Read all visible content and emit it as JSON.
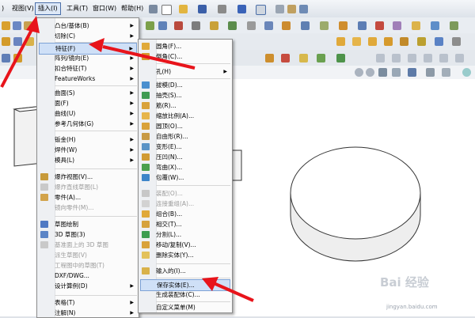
{
  "menubar": {
    "items": [
      "视图(V)",
      "插入(I)",
      "工具(T)",
      "窗口(W)",
      "帮助(H)"
    ]
  },
  "insert_menu": {
    "items": [
      {
        "label": "凸台/基体(B)",
        "has_submenu": true
      },
      {
        "label": "切除(C)",
        "has_submenu": true
      },
      {
        "label": "特征(F)",
        "has_submenu": true,
        "highlighted": true
      },
      {
        "label": "阵列/镜向(E)",
        "has_submenu": true
      },
      {
        "label": "扣合特征(T)",
        "has_submenu": true
      },
      {
        "label": "FeatureWorks",
        "has_submenu": true
      },
      {
        "label": "曲面(S)",
        "has_submenu": true
      },
      {
        "label": "面(F)",
        "has_submenu": true
      },
      {
        "label": "曲线(U)",
        "has_submenu": true
      },
      {
        "label": "参考几何体(G)",
        "has_submenu": true
      },
      {
        "label": "钣金(H)",
        "has_submenu": true
      },
      {
        "label": "焊件(W)",
        "has_submenu": true
      },
      {
        "label": "模具(L)",
        "has_submenu": true
      },
      {
        "label": "爆炸视图(V)...",
        "disabled": false
      },
      {
        "label": "爆炸直线草图(L)",
        "disabled": true
      },
      {
        "label": "零件(A)...",
        "disabled": false
      },
      {
        "label": "镜向零件(M)...",
        "disabled": true
      },
      {
        "label": "草图绘制",
        "disabled": false
      },
      {
        "label": "3D 草图(3)",
        "disabled": false
      },
      {
        "label": "基准面上的 3D 草图",
        "disabled": true
      },
      {
        "label": "派生草图(V)",
        "disabled": true
      },
      {
        "label": "工程图中的草图(T)",
        "disabled": true
      },
      {
        "label": "DXF/DWG...",
        "disabled": false
      },
      {
        "label": "设计算例(D)",
        "has_submenu": true
      },
      {
        "label": "表格(T)",
        "has_submenu": true
      },
      {
        "label": "注解(N)",
        "has_submenu": true
      }
    ]
  },
  "feature_submenu": {
    "items": [
      {
        "label": "圆角(F)...",
        "disabled": false
      },
      {
        "label": "倒角(C)...",
        "disabled": false
      },
      {
        "label": "孔(H)",
        "has_submenu": true
      },
      {
        "label": "拔模(D)...",
        "disabled": false
      },
      {
        "label": "抽壳(S)...",
        "disabled": false
      },
      {
        "label": "筋(R)...",
        "disabled": false
      },
      {
        "label": "缩放比例(A)...",
        "disabled": false
      },
      {
        "label": "圆顶(O)...",
        "disabled": false
      },
      {
        "label": "自由形(R)...",
        "disabled": false
      },
      {
        "label": "变形(E)...",
        "disabled": false
      },
      {
        "label": "压凹(N)...",
        "disabled": false
      },
      {
        "label": "弯曲(X)...",
        "disabled": false
      },
      {
        "label": "包覆(W)...",
        "disabled": false
      },
      {
        "label": "装配(O)...",
        "disabled": true
      },
      {
        "label": "连接重组(A)...",
        "disabled": true
      },
      {
        "label": "组合(B)...",
        "disabled": false
      },
      {
        "label": "相交(T)...",
        "disabled": false
      },
      {
        "label": "分割(L)...",
        "disabled": false
      },
      {
        "label": "移动/复制(V)...",
        "disabled": false
      },
      {
        "label": "删除实体(Y)...",
        "disabled": false
      },
      {
        "label": "输入的(I)...",
        "disabled": false
      },
      {
        "label": "保存实体(E)...",
        "disabled": false,
        "highlighted": true
      },
      {
        "label": "生成装配体(C)...",
        "disabled": false
      },
      {
        "label": "自定义菜单(M)",
        "disabled": false
      }
    ]
  },
  "watermark": {
    "brand": "Bai 经验",
    "url": "jingyan.baidu.com"
  },
  "colors": {
    "arrow": "#e8141b",
    "menu_highlight": "#cfe0f7"
  }
}
